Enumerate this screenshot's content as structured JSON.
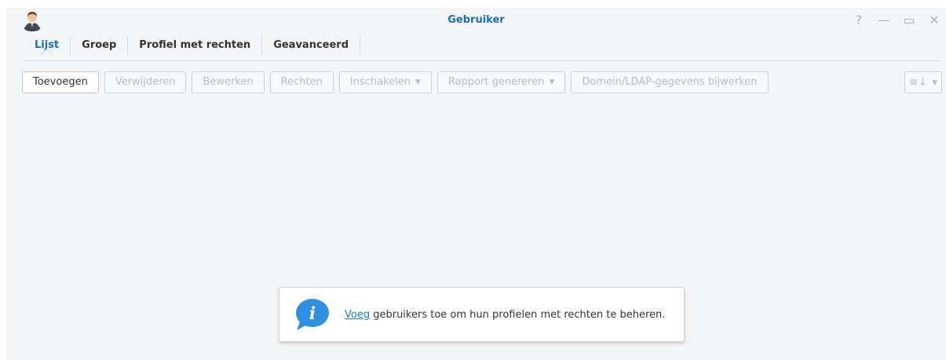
{
  "window": {
    "title": "Gebruiker",
    "controls": [
      {
        "name": "help-icon",
        "glyph": "?"
      },
      {
        "name": "minimize-icon",
        "glyph": "—"
      },
      {
        "name": "maximize-icon",
        "glyph": "▭"
      },
      {
        "name": "close-icon",
        "glyph": "✕"
      }
    ]
  },
  "tabs": [
    {
      "label": "Lijst",
      "active": true
    },
    {
      "label": "Groep"
    },
    {
      "label": "Profiel met rechten"
    },
    {
      "label": "Geavanceerd"
    }
  ],
  "toolbar": {
    "add": "Toevoegen",
    "delete": "Verwijderen",
    "edit": "Bewerken",
    "permissions": "Rechten",
    "enable": "Inschakelen",
    "report": "Rapport genereren",
    "domain_update": "Domein/LDAP-gegevens bijwerken",
    "view_icon": "≡↓"
  },
  "info": {
    "link": "Voeg",
    "text": " gebruikers toe om hun profielen met rechten te beheren."
  },
  "colors": {
    "accent": "#1d6fb3",
    "link": "#1d7ccc",
    "info_bubble": "#2f8fe0"
  }
}
